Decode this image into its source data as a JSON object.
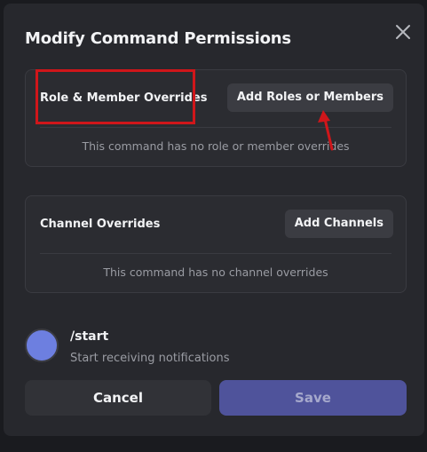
{
  "modal": {
    "title": "Modify Command Permissions"
  },
  "role_overrides": {
    "heading": "Role & Member Overrides",
    "button_label": "Add Roles or Members",
    "empty_text": "This command has no role or member overrides"
  },
  "channel_overrides": {
    "heading": "Channel Overrides",
    "button_label": "Add Channels",
    "empty_text": "This command has no channel overrides"
  },
  "command": {
    "name": "/start",
    "description": "Start receiving notifications"
  },
  "footer": {
    "cancel_label": "Cancel",
    "save_label": "Save"
  },
  "colors": {
    "accent": "#5865f2",
    "annotation": "#d0161a"
  }
}
